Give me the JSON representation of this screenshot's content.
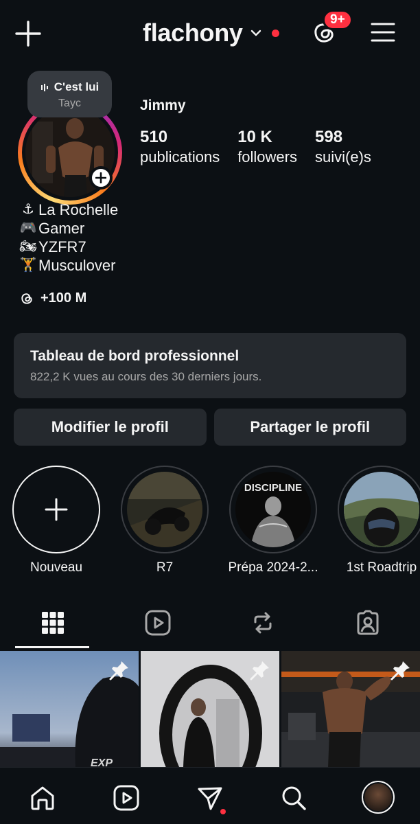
{
  "topbar": {
    "username": "flachony",
    "threads_badge": "9+"
  },
  "note": {
    "title": "C'est lui",
    "subtitle": "Tayc"
  },
  "profile": {
    "display_name": "Jimmy",
    "stats": [
      {
        "value": "510",
        "label": "publications"
      },
      {
        "value": "10 K",
        "label": "followers"
      },
      {
        "value": "598",
        "label": "suivi(e)s"
      }
    ],
    "bio": [
      {
        "emoji": "⚓",
        "text": "La Rochelle"
      },
      {
        "emoji": "🎮",
        "text": "Gamer"
      },
      {
        "emoji": "🏍",
        "text": "YZFR7"
      },
      {
        "emoji": "🏋",
        "text": "Musculover"
      }
    ],
    "threads_text": "+100 M"
  },
  "dashboard": {
    "title": "Tableau de bord professionnel",
    "subtitle": "822,2 K vues au cours des 30 derniers jours."
  },
  "buttons": {
    "edit": "Modifier le profil",
    "share": "Partager le profil"
  },
  "highlights": [
    {
      "label": "Nouveau"
    },
    {
      "label": "R7"
    },
    {
      "label": "Prépa 2024-2..."
    },
    {
      "label": "1st Roadtrip"
    }
  ],
  "highlight_texts": {
    "discipline": "DISCIPLINE"
  },
  "colors": {
    "background": "#0c1014",
    "card": "#25292e",
    "accent_red": "#ff3040",
    "muted": "#a8a8a8"
  }
}
